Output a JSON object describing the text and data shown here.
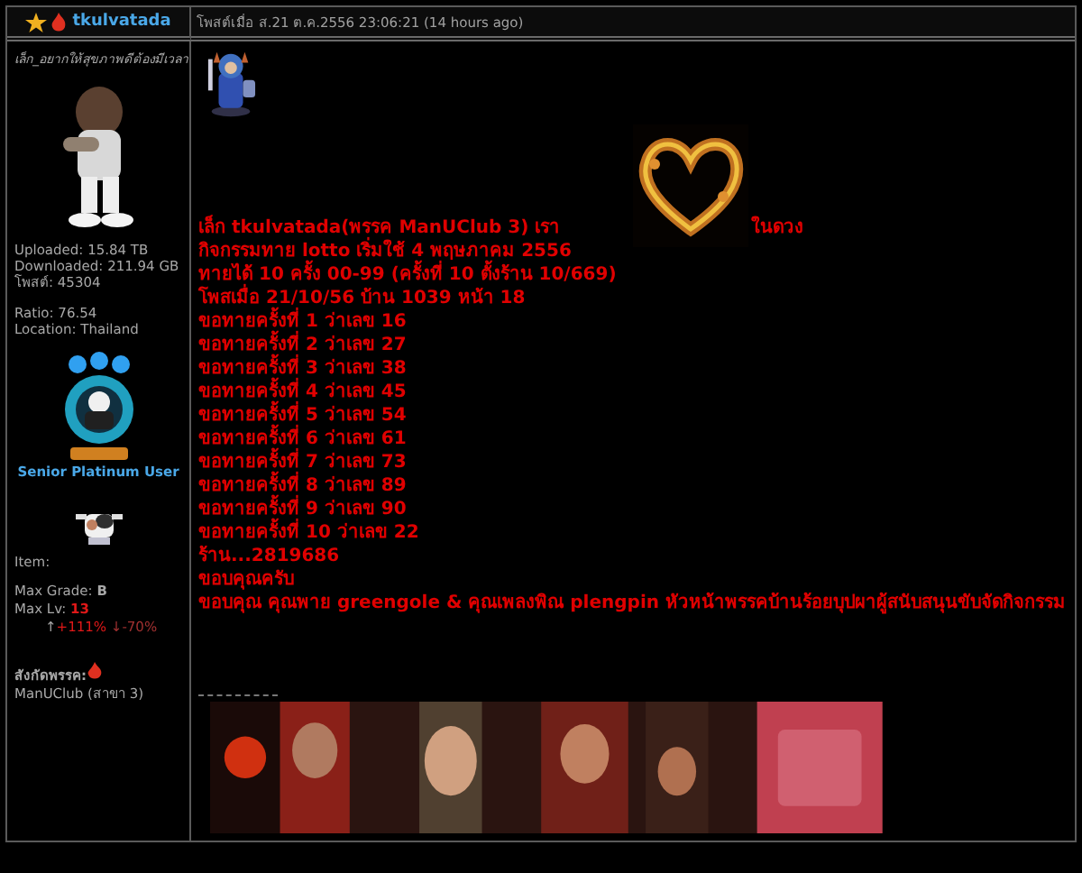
{
  "author": {
    "name": "tkulvatada",
    "title": "เล็ก_อยากให้สุขภาพดีต้องมีเวลา",
    "stats": [
      "Uploaded: 15.84 TB",
      "Downloaded: 211.94 GB",
      "โพสต์: 45304"
    ],
    "stats2": [
      "Ratio: 76.54",
      "Location: Thailand"
    ],
    "rank": "Senior Platinum User",
    "item_label": "Item:",
    "max_grade_label": "Max Grade:",
    "max_grade": "B",
    "max_lv_label": "Max Lv:",
    "max_lv": "13",
    "up_arrow": "↑",
    "up": "+111%",
    "down": "↓-70%",
    "party_label": "สังกัดพรรค:",
    "party": "ManUClub (สาขา 3)"
  },
  "post": {
    "posted": "โพสต์เมื่อ ส.21 ต.ค.2556 23:06:21 (14 hours ago)",
    "intro_before": "เล็ก tkulvatada(พรรค ManUClub 3) เรา",
    "intro_after": "ในดวง",
    "lines": [
      "กิจกรรมทาย lotto เริ่มใช้ 4 พฤษภาคม 2556",
      "ทายได้ 10 ครั้ง 00-99 (ครั้งที่ 10 ตั้งร้าน 10/669)",
      "โพสเมื่อ 21/10/56 บ้าน 1039 หน้า 18",
      "ขอทายครั้งที่ 1  ว่าเลข 16",
      "ขอทายครั้งที่ 2  ว่าเลข 27",
      "ขอทายครั้งที่ 3  ว่าเลข 38",
      "ขอทายครั้งที่ 4  ว่าเลข 45",
      "ขอทายครั้งที่ 5  ว่าเลข 54",
      "ขอทายครั้งที่ 6  ว่าเลข 61",
      "ขอทายครั้งที่ 7  ว่าเลข 73",
      "ขอทายครั้งที่ 8  ว่าเลข 89",
      "ขอทายครั้งที่ 9  ว่าเลข 90",
      "ขอทายครั้งที่ 10  ว่าเลข 22",
      "ร้าน...2819686",
      "ขอบคุณครับ",
      "ขอบคุณ  คุณพาย greengole  & คุณเพลงพิณ plengpin หัวหน้าพรรคบ้านร้อยบุปผาผู้สนับสนุนขับจัดกิจกรรม"
    ]
  }
}
